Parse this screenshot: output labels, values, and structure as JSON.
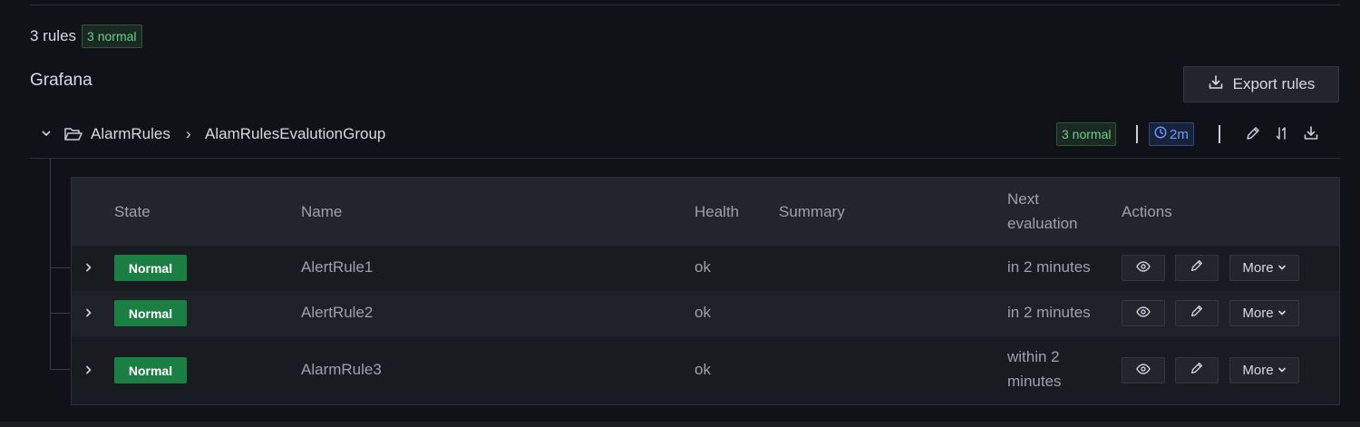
{
  "summary": {
    "rules_count": "3 rules",
    "normal_badge": "3 normal"
  },
  "datasource": {
    "title": "Grafana",
    "export_label": "Export rules",
    "export_icon": "download-icon"
  },
  "group": {
    "folder": "AlarmRules",
    "separator": "›",
    "name": "AlamRulesEvalutionGroup",
    "state_badge": "3 normal",
    "interval": "2m",
    "actions": [
      "edit-icon",
      "reorder-icon",
      "download-icon"
    ]
  },
  "table": {
    "headers": {
      "state": "State",
      "name": "Name",
      "health": "Health",
      "summary": "Summary",
      "next_line1": "Next",
      "next_line2": "evaluation",
      "actions": "Actions"
    },
    "rows": [
      {
        "state": "Normal",
        "name": "AlertRule1",
        "health": "ok",
        "summary": "",
        "next_line1": "in 2 minutes",
        "next_line2": "",
        "more": "More"
      },
      {
        "state": "Normal",
        "name": "AlertRule2",
        "health": "ok",
        "summary": "",
        "next_line1": "in 2 minutes",
        "next_line2": "",
        "more": "More"
      },
      {
        "state": "Normal",
        "name": "AlarmRule3",
        "health": "ok",
        "summary": "",
        "next_line1": "within 2",
        "next_line2": "minutes",
        "more": "More"
      }
    ]
  },
  "colors": {
    "normal_state": "#1b7f43",
    "interval_blue": "#6e9fff",
    "badge_green": "#6ccf8e"
  }
}
